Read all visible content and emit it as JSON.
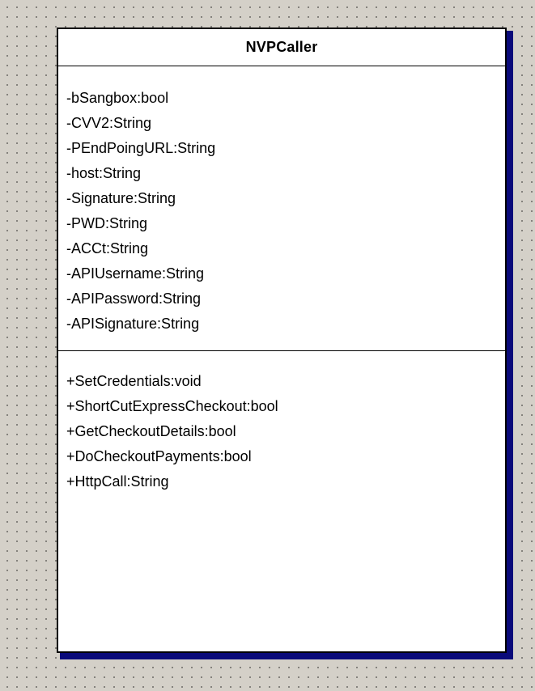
{
  "diagram": {
    "class_name": "NVPCaller",
    "attributes": [
      "-bSangbox:bool",
      "-CVV2:String",
      "-PEndPoingURL:String",
      "-host:String",
      "-Signature:String",
      "-PWD:String",
      "-ACCt:String",
      "-APIUsername:String",
      "-APIPassword:String",
      "-APISignature:String"
    ],
    "methods": [
      "+SetCredentials:void",
      "+ShortCutExpressCheckout:bool",
      "+GetCheckoutDetails:bool",
      "+DoCheckoutPayments:bool",
      "+HttpCall:String"
    ]
  },
  "colors": {
    "canvas_background": "#d4d0c8",
    "grid_dots": "#1a1a1a",
    "class_fill": "#ffffff",
    "class_border": "#000000",
    "shadow": "#0a0a7a"
  }
}
